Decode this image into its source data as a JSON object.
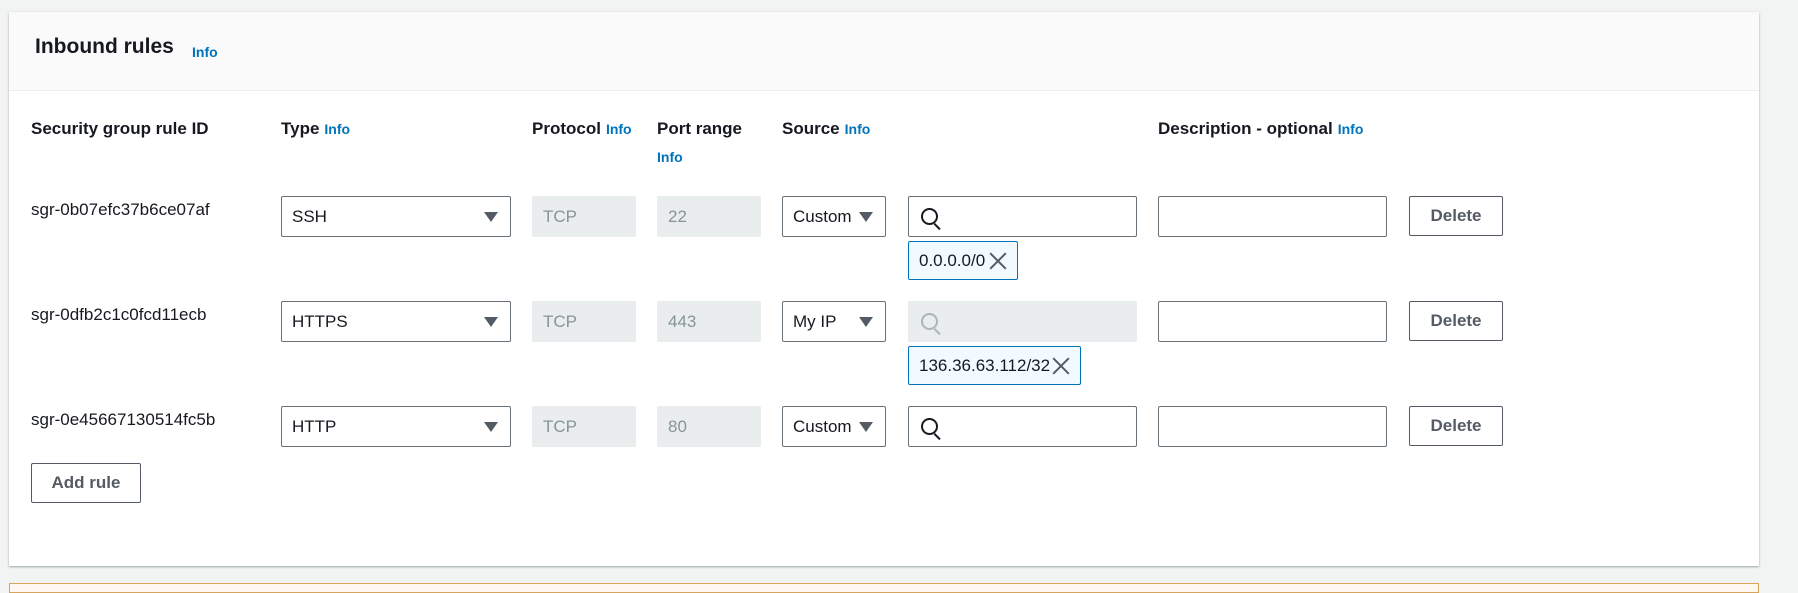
{
  "panel": {
    "title": "Inbound rules",
    "title_info": "Info"
  },
  "columns": {
    "rule_id": "Security group rule ID",
    "type": "Type",
    "type_info": "Info",
    "protocol": "Protocol",
    "protocol_info": "Info",
    "port_range": "Port range",
    "port_range_info": "Info",
    "source": "Source",
    "source_info": "Info",
    "description": "Description - optional",
    "description_info": "Info"
  },
  "rules": [
    {
      "id": "sgr-0b07efc37b6ce07af",
      "type": "SSH",
      "protocol": "TCP",
      "port_range": "22",
      "source": "Custom",
      "search_value": "",
      "token": "0.0.0.0/0",
      "description": "",
      "delete_label": "Delete"
    },
    {
      "id": "sgr-0dfb2c1c0fcd11ecb",
      "type": "HTTPS",
      "protocol": "TCP",
      "port_range": "443",
      "source": "My IP",
      "search_value": "",
      "token": "136.36.63.112/32",
      "description": "",
      "delete_label": "Delete"
    },
    {
      "id": "sgr-0e45667130514fc5b",
      "type": "HTTP",
      "protocol": "TCP",
      "port_range": "80",
      "source": "Custom",
      "search_value": "",
      "token": "",
      "description": "",
      "delete_label": "Delete"
    }
  ],
  "actions": {
    "add_rule": "Add rule"
  },
  "colors": {
    "accent": "#0073bb",
    "token_bg": "#f1faff",
    "disabled_bg": "#eaeded",
    "warning_border": "#d5a55d"
  },
  "icons": {
    "search": "search-icon",
    "dropdown": "caret-down-icon",
    "remove": "close-icon"
  }
}
